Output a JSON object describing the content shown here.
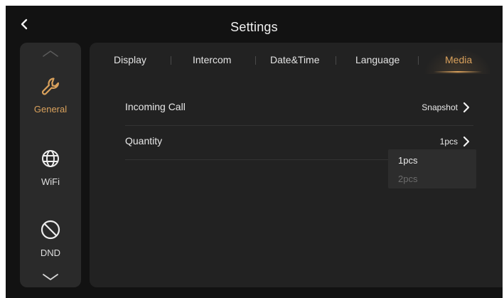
{
  "header": {
    "title": "Settings"
  },
  "sidebar": {
    "items": [
      {
        "label": "General",
        "icon": "wrench-icon",
        "active": true
      },
      {
        "label": "WiFi",
        "icon": "globe-icon",
        "active": false
      },
      {
        "label": "DND",
        "icon": "prohibited-icon",
        "active": false
      }
    ]
  },
  "tabs": [
    {
      "label": "Display",
      "active": false
    },
    {
      "label": "Intercom",
      "active": false
    },
    {
      "label": "Date&Time",
      "active": false
    },
    {
      "label": "Language",
      "active": false
    },
    {
      "label": "Media",
      "active": true
    }
  ],
  "settings": {
    "rows": [
      {
        "label": "Incoming Call",
        "value": "Snapshot"
      },
      {
        "label": "Quantity",
        "value": "1pcs"
      }
    ]
  },
  "dropdown": {
    "options": [
      "1pcs",
      "2pcs"
    ],
    "selected": "1pcs"
  },
  "colors": {
    "accent": "#d9a15c",
    "background": "#121212",
    "sidebar": "#2a2a2a",
    "panel": "#222222",
    "text": "#e8e8e8",
    "muted": "#6c6c6c"
  }
}
